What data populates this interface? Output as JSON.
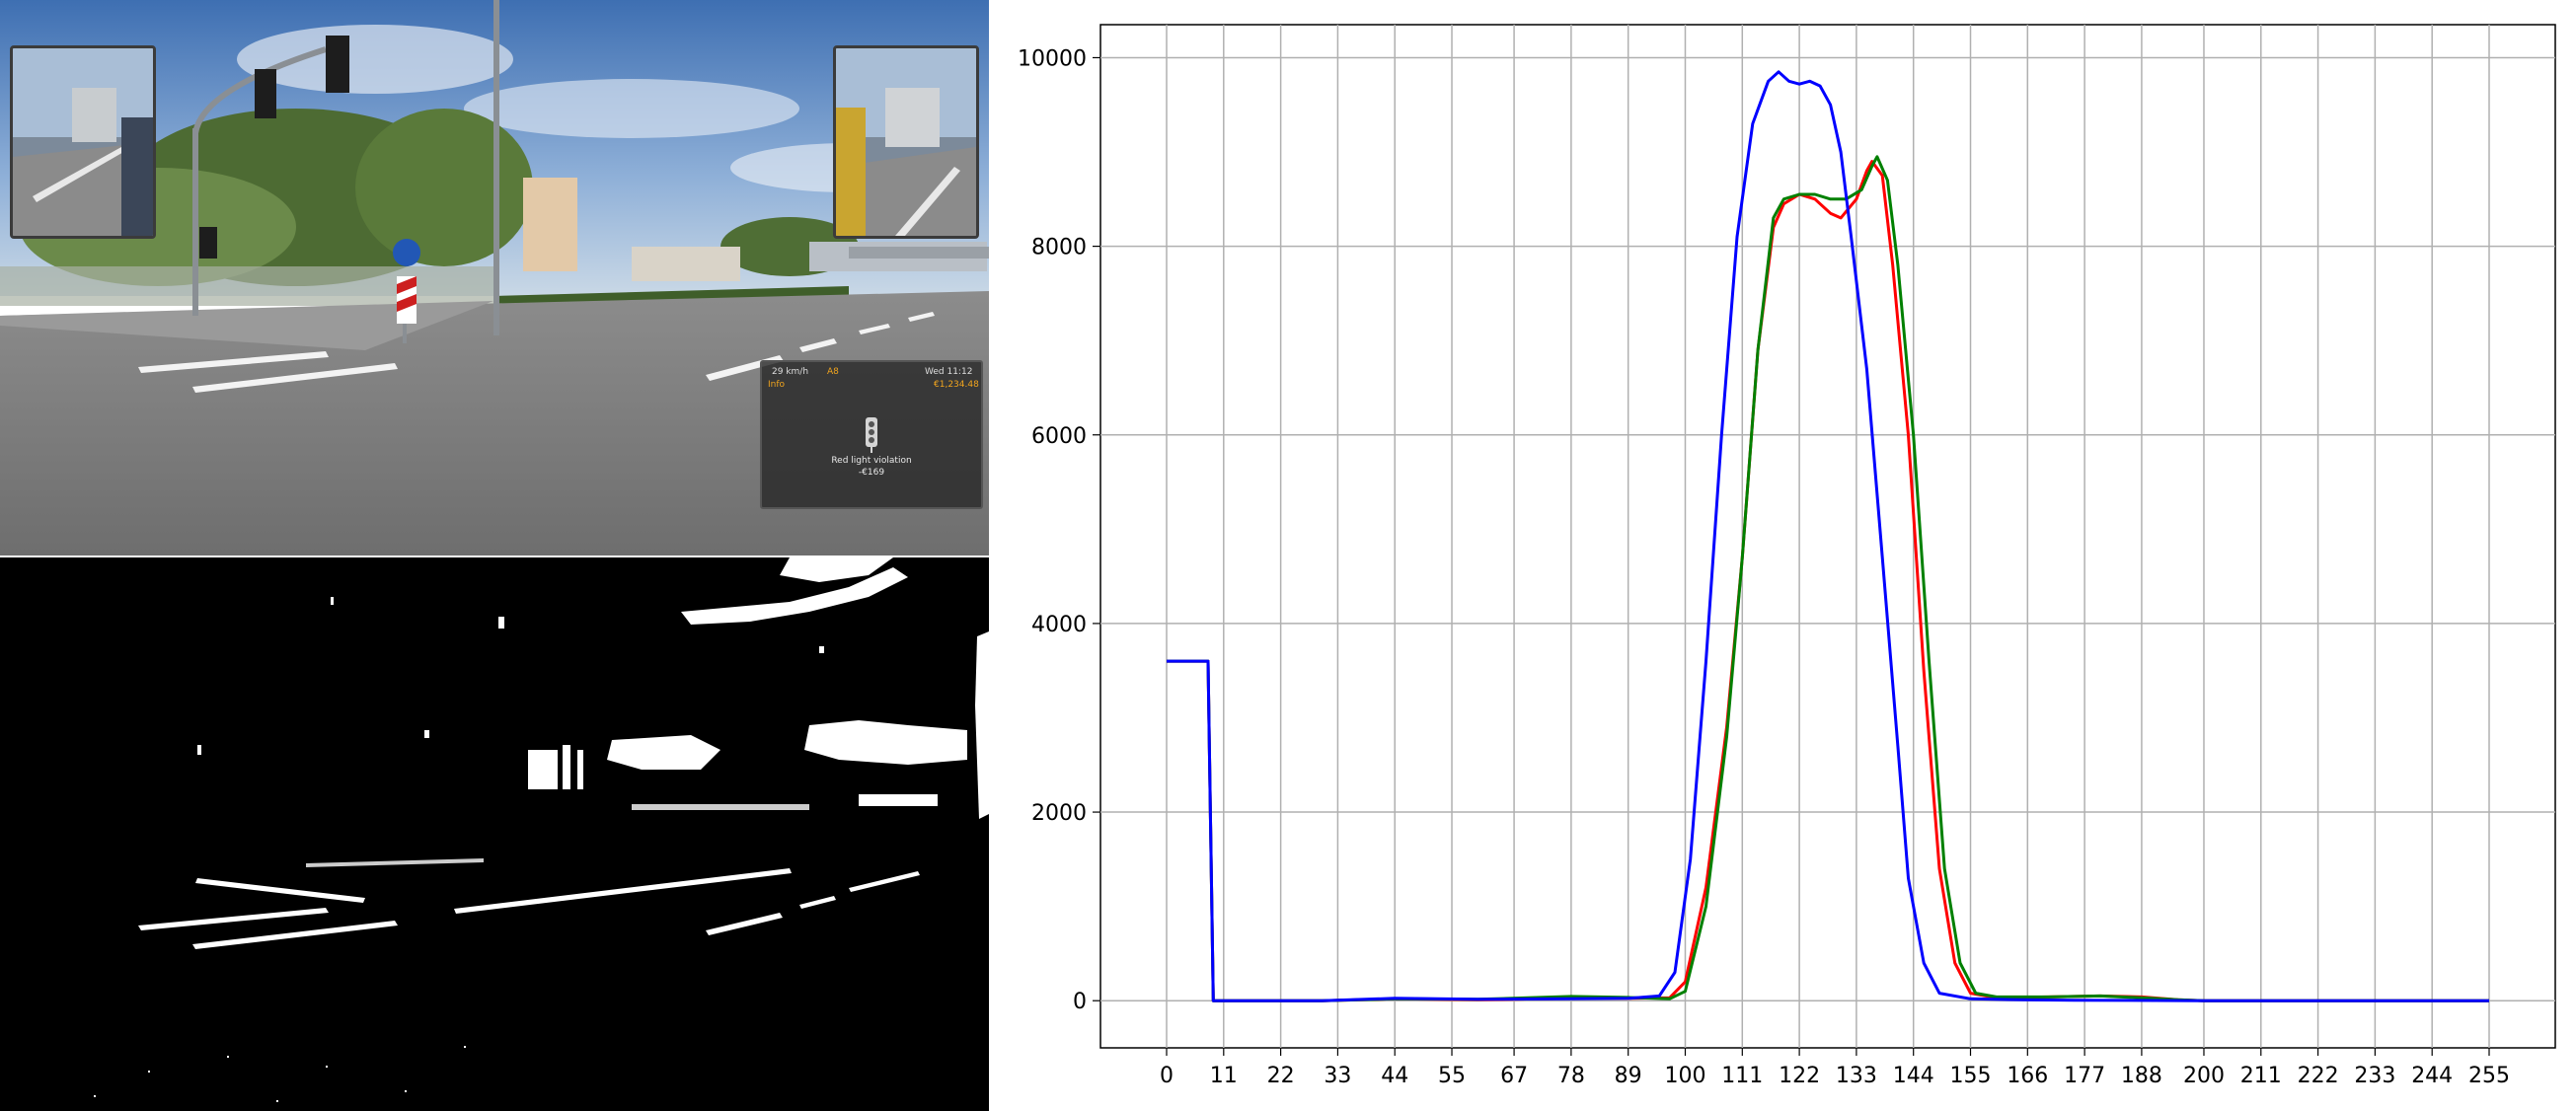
{
  "hud": {
    "speed": "29 km/h",
    "cruise": "A8",
    "time": "Wed 11:12",
    "info_label": "Info",
    "money": "€1,234.48",
    "message": "Red light violation",
    "fine": "-€169"
  },
  "colors": {
    "red": "#ff0000",
    "green": "#008000",
    "blue": "#0000ff",
    "grid": "#b0b0b0",
    "hud_accent": "#f0a41e"
  },
  "chart_data": {
    "type": "line",
    "title": "",
    "xlabel": "",
    "ylabel": "",
    "xlim": [
      0,
      255
    ],
    "ylim": [
      -500,
      10350
    ],
    "grid": true,
    "x_ticks": [
      0,
      11,
      22,
      33,
      44,
      55,
      67,
      78,
      89,
      100,
      111,
      122,
      133,
      144,
      155,
      166,
      177,
      188,
      200,
      211,
      222,
      233,
      244,
      255
    ],
    "y_ticks": [
      0,
      2000,
      4000,
      6000,
      8000,
      10000
    ],
    "series": [
      {
        "color": "red",
        "points": [
          [
            0,
            3600
          ],
          [
            8,
            3600
          ],
          [
            9,
            0
          ],
          [
            30,
            0
          ],
          [
            44,
            20
          ],
          [
            60,
            10
          ],
          [
            78,
            25
          ],
          [
            89,
            25
          ],
          [
            97,
            30
          ],
          [
            100,
            200
          ],
          [
            104,
            1200
          ],
          [
            108,
            2900
          ],
          [
            111,
            4700
          ],
          [
            114,
            6900
          ],
          [
            117,
            8200
          ],
          [
            119,
            8450
          ],
          [
            122,
            8550
          ],
          [
            125,
            8500
          ],
          [
            128,
            8350
          ],
          [
            130,
            8300
          ],
          [
            133,
            8500
          ],
          [
            135,
            8800
          ],
          [
            136,
            8900
          ],
          [
            138,
            8750
          ],
          [
            140,
            7800
          ],
          [
            143,
            6000
          ],
          [
            146,
            3500
          ],
          [
            149,
            1400
          ],
          [
            152,
            400
          ],
          [
            155,
            80
          ],
          [
            160,
            30
          ],
          [
            170,
            40
          ],
          [
            180,
            50
          ],
          [
            188,
            40
          ],
          [
            195,
            10
          ],
          [
            200,
            0
          ],
          [
            255,
            0
          ]
        ]
      },
      {
        "color": "green",
        "points": [
          [
            0,
            3600
          ],
          [
            8,
            3600
          ],
          [
            9,
            0
          ],
          [
            30,
            0
          ],
          [
            44,
            20
          ],
          [
            60,
            15
          ],
          [
            78,
            45
          ],
          [
            89,
            35
          ],
          [
            97,
            20
          ],
          [
            100,
            100
          ],
          [
            104,
            1000
          ],
          [
            108,
            2800
          ],
          [
            111,
            4700
          ],
          [
            114,
            6900
          ],
          [
            117,
            8300
          ],
          [
            119,
            8500
          ],
          [
            122,
            8550
          ],
          [
            125,
            8550
          ],
          [
            128,
            8500
          ],
          [
            131,
            8500
          ],
          [
            134,
            8600
          ],
          [
            136,
            8850
          ],
          [
            137,
            8950
          ],
          [
            139,
            8700
          ],
          [
            141,
            7800
          ],
          [
            144,
            6000
          ],
          [
            147,
            3600
          ],
          [
            150,
            1400
          ],
          [
            153,
            400
          ],
          [
            156,
            80
          ],
          [
            160,
            40
          ],
          [
            170,
            40
          ],
          [
            180,
            50
          ],
          [
            188,
            30
          ],
          [
            195,
            10
          ],
          [
            200,
            0
          ],
          [
            255,
            0
          ]
        ]
      },
      {
        "color": "blue",
        "points": [
          [
            0,
            3600
          ],
          [
            8,
            3600
          ],
          [
            9,
            0
          ],
          [
            30,
            0
          ],
          [
            44,
            25
          ],
          [
            60,
            15
          ],
          [
            78,
            20
          ],
          [
            89,
            25
          ],
          [
            95,
            50
          ],
          [
            98,
            300
          ],
          [
            101,
            1500
          ],
          [
            104,
            3600
          ],
          [
            107,
            6000
          ],
          [
            110,
            8100
          ],
          [
            113,
            9300
          ],
          [
            116,
            9750
          ],
          [
            118,
            9850
          ],
          [
            120,
            9750
          ],
          [
            122,
            9720
          ],
          [
            124,
            9750
          ],
          [
            126,
            9700
          ],
          [
            128,
            9500
          ],
          [
            130,
            9000
          ],
          [
            132,
            8100
          ],
          [
            135,
            6700
          ],
          [
            138,
            4700
          ],
          [
            141,
            2700
          ],
          [
            143,
            1300
          ],
          [
            146,
            400
          ],
          [
            149,
            80
          ],
          [
            155,
            20
          ],
          [
            165,
            10
          ],
          [
            175,
            5
          ],
          [
            200,
            0
          ],
          [
            255,
            0
          ]
        ]
      }
    ]
  }
}
